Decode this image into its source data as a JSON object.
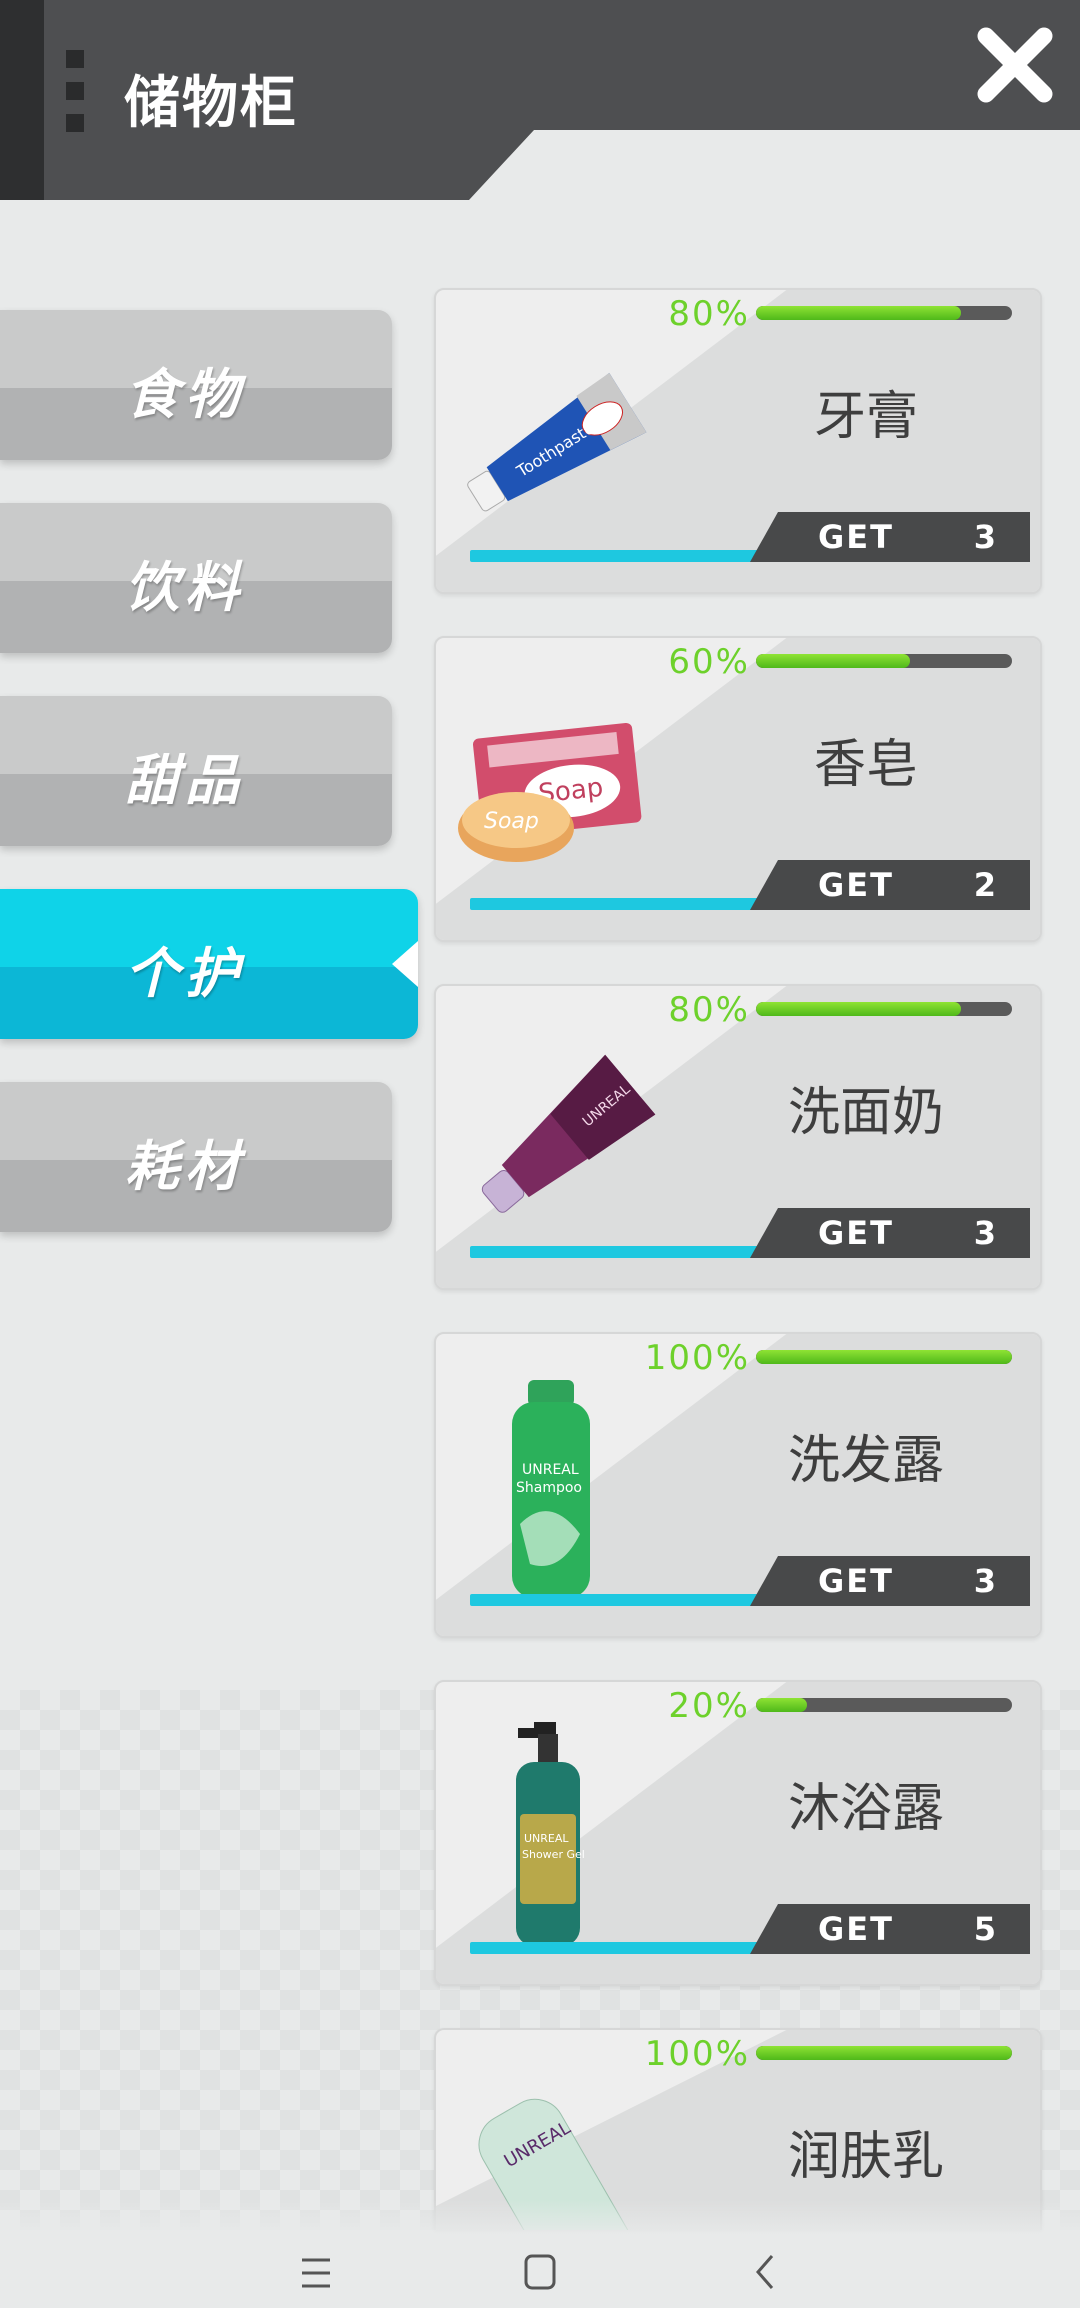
{
  "header": {
    "title": "储物柜",
    "close_icon": "close-icon"
  },
  "tabs": [
    {
      "label": "食物",
      "active": false
    },
    {
      "label": "饮料",
      "active": false
    },
    {
      "label": "甜品",
      "active": false
    },
    {
      "label": "个护",
      "active": true
    },
    {
      "label": "耗材",
      "active": false
    }
  ],
  "items": [
    {
      "name": "牙膏",
      "percent_text": "80%",
      "percent": 80,
      "get_label": "GET",
      "count": "3",
      "icon": "toothpaste-icon"
    },
    {
      "name": "香皂",
      "percent_text": "60%",
      "percent": 60,
      "get_label": "GET",
      "count": "2",
      "icon": "soap-icon"
    },
    {
      "name": "洗面奶",
      "percent_text": "80%",
      "percent": 80,
      "get_label": "GET",
      "count": "3",
      "icon": "face-wash-icon"
    },
    {
      "name": "洗发露",
      "percent_text": "100%",
      "percent": 100,
      "get_label": "GET",
      "count": "3",
      "icon": "shampoo-icon"
    },
    {
      "name": "沐浴露",
      "percent_text": "20%",
      "percent": 20,
      "get_label": "GET",
      "count": "5",
      "icon": "shower-gel-icon"
    },
    {
      "name": "润肤乳",
      "percent_text": "100%",
      "percent": 100,
      "icon": "lotion-icon"
    }
  ],
  "colors": {
    "accent": "#0fd3e8",
    "progress": "#6dd12b",
    "header": "#4e4f51"
  },
  "nav": {
    "menu_icon": "menu-icon",
    "home_icon": "home-icon",
    "back_icon": "back-icon"
  }
}
